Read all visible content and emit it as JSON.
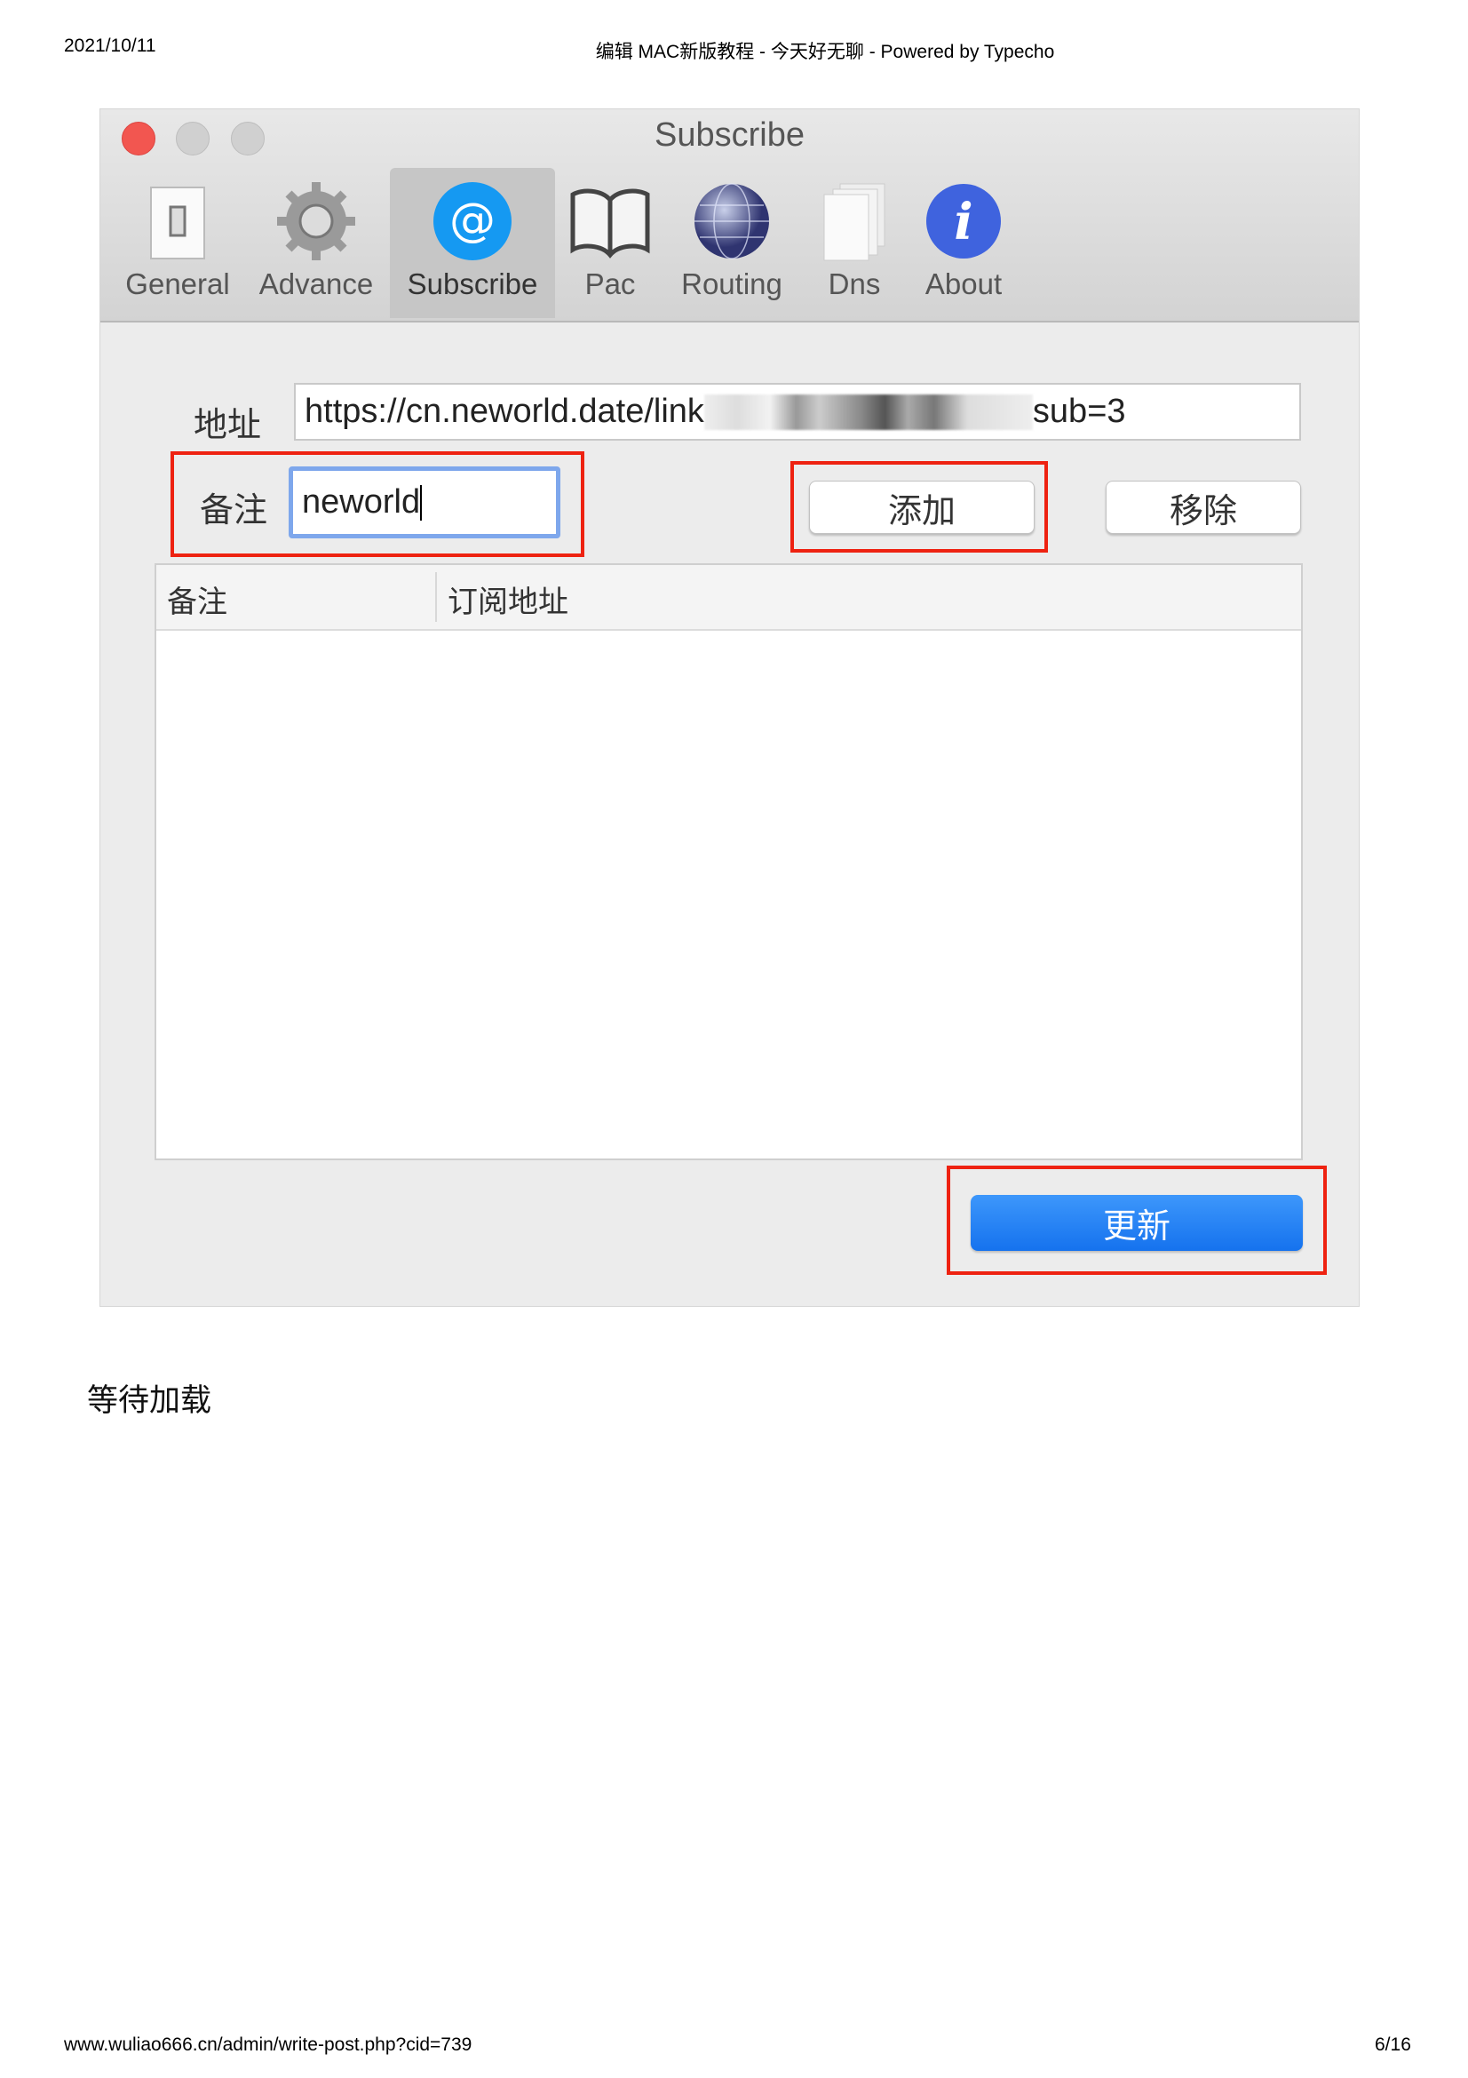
{
  "page_header": {
    "date": "2021/10/11",
    "title": "编辑 MAC新版教程 - 今天好无聊 - Powered by Typecho"
  },
  "window": {
    "title": "Subscribe",
    "toolbar": [
      {
        "label": "General",
        "icon": "switch-icon"
      },
      {
        "label": "Advance",
        "icon": "gear-icon"
      },
      {
        "label": "Subscribe",
        "icon": "at-sign-icon",
        "selected": true
      },
      {
        "label": "Pac",
        "icon": "book-icon"
      },
      {
        "label": "Routing",
        "icon": "globe-icon"
      },
      {
        "label": "Dns",
        "icon": "documents-icon"
      },
      {
        "label": "About",
        "icon": "info-icon"
      }
    ],
    "address_label": "地址",
    "address_value_prefix": "https://cn.neworld.date/link",
    "address_value_suffix": "sub=3",
    "remark_label": "备注",
    "remark_value": "neworld",
    "add_button": "添加",
    "remove_button": "移除",
    "table": {
      "columns": [
        "备注",
        "订阅地址"
      ],
      "rows": []
    },
    "update_button": "更新",
    "colors": {
      "accent": "#1a7ff5",
      "highlight_box": "#ee2211",
      "close": "#f25650"
    }
  },
  "body_text": "等待加载",
  "page_footer": {
    "url": "www.wuliao666.cn/admin/write-post.php?cid=739",
    "page": "6/16"
  }
}
